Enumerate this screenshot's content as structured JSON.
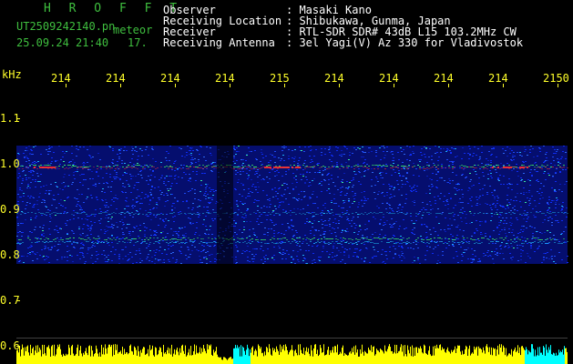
{
  "header": {
    "app_title": "H R O F F T",
    "filename": "UT2509242140.pn",
    "label_meteor": "meteor",
    "datetime": "25.09.24 21:40",
    "counter": "17.",
    "info": [
      {
        "key": "Observer",
        "value": ": Masaki Kano"
      },
      {
        "key": "Receiving Location",
        "value": ": Shibukawa, Gunma, Japan"
      },
      {
        "key": "Receiver",
        "value": ": RTL-SDR SDR# 43dB L15 103.2MHz CW"
      },
      {
        "key": "Receiving Antenna",
        "value": ": 3el Yagi(V) Az 330 for Vladivostok"
      }
    ]
  },
  "axis": {
    "y_unit": "kHz",
    "y_ticks": [
      "1.1",
      "1.0",
      "0.9",
      "0.8",
      "0.7",
      "0.6"
    ],
    "x_ticks": [
      "214",
      "214",
      "214",
      "214",
      "215",
      "214",
      "214",
      "214",
      "214",
      "2150"
    ]
  },
  "colors": {
    "title_green": "#3fbf3f",
    "text_white": "#ffffff",
    "tick_yellow": "#ffff2a",
    "background": "#000000",
    "spectrum_blue": "#0a1ec8",
    "signal_red": "#ff3030",
    "signal_green": "#40ff60",
    "bar_yellow": "#ffff00",
    "bar_cyan": "#00ffff"
  }
}
